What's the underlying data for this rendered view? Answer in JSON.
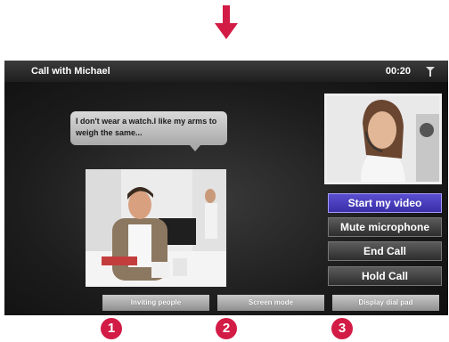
{
  "window": {
    "title": "Call with Michael",
    "timer": "00:20"
  },
  "chat": {
    "message": "I don't wear a watch.I like my arms to weigh the same..."
  },
  "side_buttons": [
    {
      "label": "Start my video",
      "active": true
    },
    {
      "label": "Mute microphone",
      "active": false
    },
    {
      "label": "End Call",
      "active": false
    },
    {
      "label": "Hold Call",
      "active": false
    }
  ],
  "bottom_buttons": [
    {
      "label": "Inviting people"
    },
    {
      "label": "Screen mode"
    },
    {
      "label": "Display dial pad"
    }
  ],
  "callouts": [
    "1",
    "2",
    "3"
  ],
  "icons": {
    "arrow": "arrow-down-icon",
    "signal": "signal-icon"
  },
  "colors": {
    "accent": "#d21c45",
    "active_button": "#4a3fc0"
  }
}
